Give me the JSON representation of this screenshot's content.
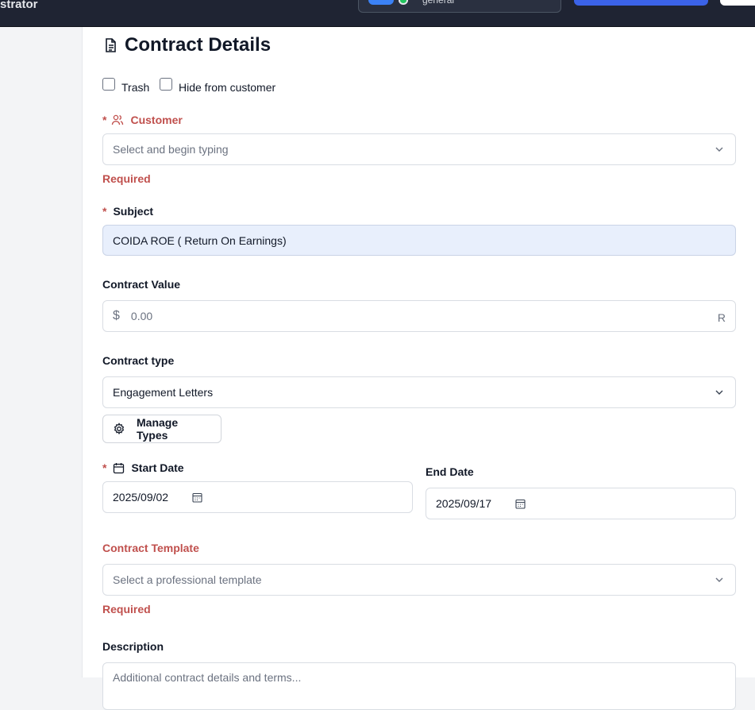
{
  "topbar": {
    "role_text": "strator",
    "workspace_label": "general"
  },
  "form": {
    "title": "Contract Details",
    "checkboxes": [
      {
        "label": "Trash",
        "checked": false
      },
      {
        "label": "Hide from customer",
        "checked": false
      }
    ],
    "required_marker": "*",
    "customer": {
      "label": "Customer",
      "placeholder": "Select and begin typing",
      "error": "Required"
    },
    "subject": {
      "label": "Subject",
      "value": "COIDA ROE ( Return On Earnings)"
    },
    "contract_value": {
      "label": "Contract Value",
      "currency_symbol": "$",
      "placeholder": "0.00",
      "suffix": "R"
    },
    "contract_type": {
      "label": "Contract type",
      "selected": "Engagement Letters",
      "manage_button": "Manage Types"
    },
    "start_date": {
      "label": "Start Date",
      "value": "2025/09/02"
    },
    "end_date": {
      "label": "End Date",
      "value": "2025/09/17"
    },
    "contract_template": {
      "label": "Contract Template",
      "placeholder": "Select a professional template",
      "error": "Required"
    },
    "description": {
      "label": "Description",
      "placeholder": "Additional contract details and terms..."
    }
  },
  "colors": {
    "topbar_bg": "#1f2433",
    "accent_blue": "#3b63e8",
    "error_red": "#c0504d",
    "subject_bg": "#e8effc"
  }
}
